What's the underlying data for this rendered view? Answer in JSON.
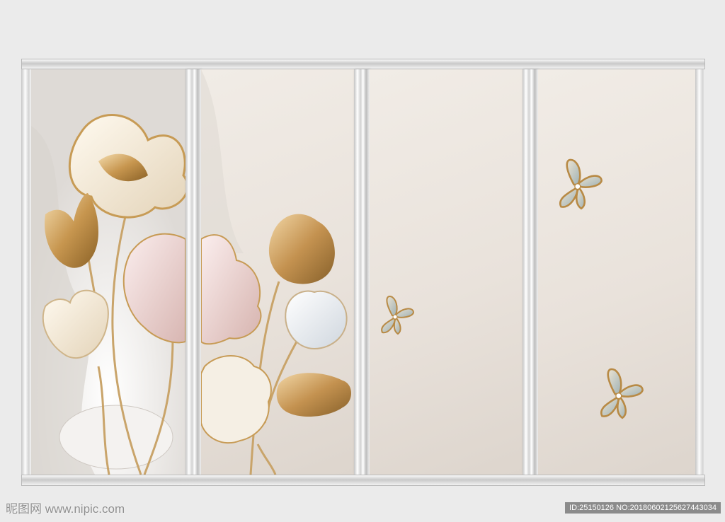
{
  "watermark": {
    "site": "昵图网 www.nipic.com",
    "id_line": "ID:25150126 NO:20180602125627443034"
  },
  "colors": {
    "frame": "#d6d6d6",
    "panel_background": "#ece6df",
    "gold": "#c89b55",
    "blush": "#e9cfcc",
    "ivory": "#f6efe3"
  },
  "content": {
    "panel_count": 4,
    "flower_types": [
      "tulip",
      "poppy"
    ],
    "butterfly_count": 3
  }
}
